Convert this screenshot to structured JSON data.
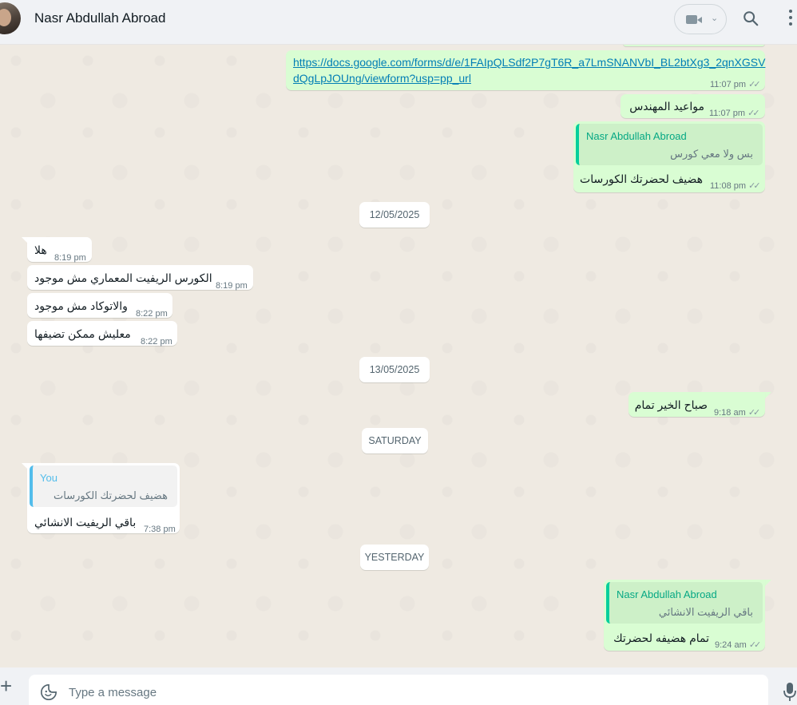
{
  "header": {
    "contact_name": "Nasr Abdullah Abroad",
    "video_chevron": "⌄"
  },
  "messages": {
    "link": {
      "line1": "https://docs.google.com/forms/d/e/1FAIpQLSdf2P7gT6R_a7LmSNANVbI_BL2btXg3_2qnXGSV",
      "line2": "dQgLpJOUng/viewform?usp=pp_url",
      "time": "11:07 pm"
    },
    "m1": {
      "text": "مواعيد المهندس",
      "time": "11:07 pm"
    },
    "m2": {
      "quote_author": "Nasr Abdullah Abroad",
      "quote_text": "بس ولا معي كورس",
      "text": "هضيف لحضرتك الكورسات",
      "time": "11:08 pm"
    },
    "date1": "12/05/2025",
    "m3": {
      "text": "هلا",
      "time": "8:19 pm"
    },
    "m4": {
      "text": "الكورس الريفيت المعماري مش موجود",
      "time": "8:19 pm"
    },
    "m5": {
      "text": "والاتوكاد مش موجود",
      "time": "8:22 pm"
    },
    "m6": {
      "text": "معليش ممكن تضيفها",
      "time": "8:22 pm"
    },
    "date2": "13/05/2025",
    "m7": {
      "text": "صباح الخير تمام",
      "time": "9:18 am"
    },
    "date3": "SATURDAY",
    "m8": {
      "quote_author": "You",
      "quote_text": "هضيف لحضرتك الكورسات",
      "text": "باقي الريفيت الانشائي",
      "time": "7:38 pm"
    },
    "date4": "YESTERDAY",
    "m9": {
      "quote_author": "Nasr Abdullah Abroad",
      "quote_text": "باقي الريفيت الانشائي",
      "text": "تمام هضيفه لحضرتك",
      "time": "9:24 am"
    }
  },
  "footer": {
    "placeholder": "Type a message",
    "plus": "+"
  },
  "icons": [
    "avatar",
    "video-call-icon",
    "search-icon",
    "menu-icon",
    "plus-icon",
    "emoji-icon",
    "mic-icon",
    "double-check-icon"
  ],
  "colors": {
    "outgoing_bubble": "#d9fdd3",
    "incoming_bubble": "#ffffff",
    "chat_bg": "#efeae2",
    "accent_green": "#06cf9c",
    "read_tick": "#8696a0",
    "link": "#027eb5"
  }
}
